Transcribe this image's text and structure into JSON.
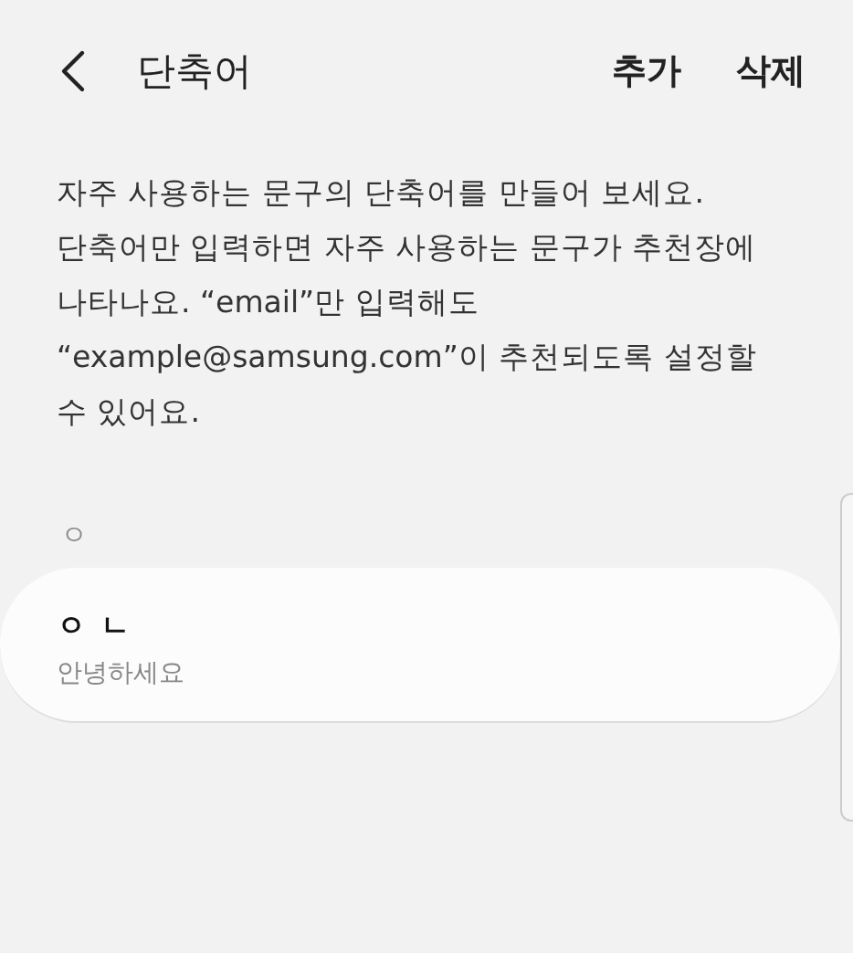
{
  "header": {
    "title": "단축어",
    "actions": [
      "추가",
      "삭제"
    ]
  },
  "description": "자주 사용하는 문구의 단축어를 만들어 보세요.\n단축어만 입력하면 자주 사용하는 문구가 추천장에\n나타나요. “email”만 입력해도\n“example@samsung.com”이 추천되도록 설정할\n수 있어요.",
  "sections": [
    {
      "index": "ㅇ",
      "items": [
        {
          "shortcut": "ㅇㄴ",
          "phrase": "안녕하세요"
        }
      ]
    }
  ]
}
